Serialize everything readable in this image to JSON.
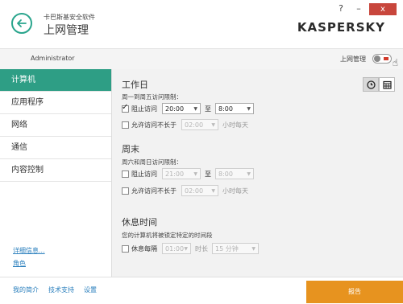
{
  "header": {
    "app_name": "卡巴斯基安全软件",
    "page_title": "上网管理",
    "help": "?",
    "minimize": "–",
    "close": "x",
    "logo_main": "KASPERSKY",
    "logo_suffix": "",
    "logo_ru": "ǀ"
  },
  "userbar": {
    "username": "Administrator",
    "parental_label": "上网管理",
    "toggle_on": true
  },
  "sidebar": {
    "items": [
      {
        "label": "计算机",
        "active": true
      },
      {
        "label": "应用程序"
      },
      {
        "label": "网络"
      },
      {
        "label": "通信"
      },
      {
        "label": "内容控制"
      }
    ],
    "link_details": "详细信息...",
    "link_roles": "角色"
  },
  "main": {
    "workday": {
      "title": "工作日",
      "desc": "周一到周五访问限制：",
      "block_label": "阻止访问",
      "block_from": "20:00",
      "to_word": "至",
      "block_to": "8:00",
      "allow_label": "允许访问不长于",
      "allow_value": "02:00",
      "per_day": "小时每天"
    },
    "weekend": {
      "title": "周末",
      "desc": "周六和周日访问限制：",
      "block_label": "阻止访问",
      "block_from": "21:00",
      "to_word": "至",
      "block_to": "8:00",
      "allow_label": "允许访问不长于",
      "allow_value": "02:00",
      "per_day": "小时每天"
    },
    "rest": {
      "title": "休息时间",
      "desc": "您的计算机将被锁定特定的时间段",
      "rest_label": "休息每隔",
      "rest_every": "01:00",
      "duration_label": "时长",
      "duration_value": "15 分钟"
    }
  },
  "footer": {
    "my_profile": "我的简介",
    "support": "技术支持",
    "settings": "设置",
    "report_button": "报告"
  },
  "colors": {
    "accent": "#2e9e85",
    "report": "#e7931f",
    "close": "#c8463c"
  }
}
